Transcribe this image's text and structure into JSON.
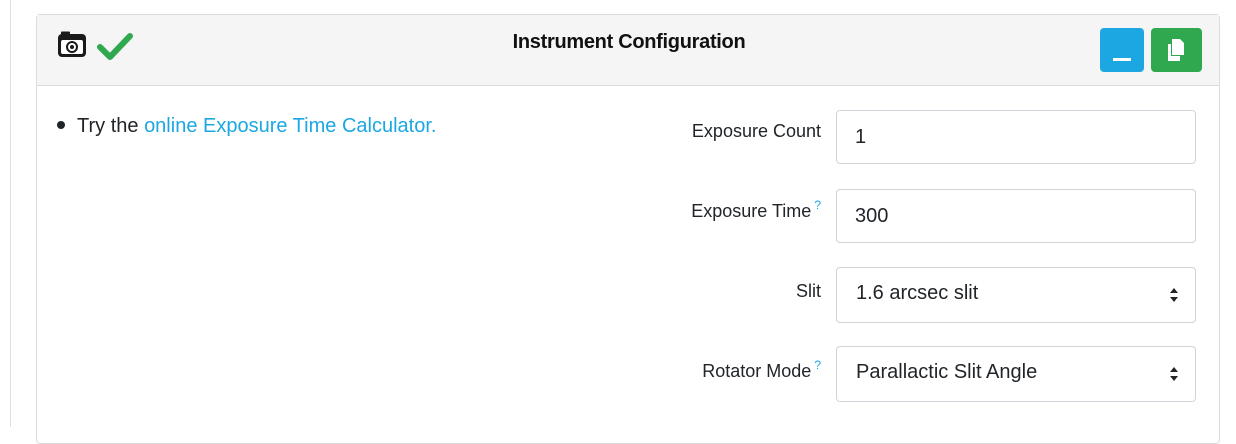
{
  "header": {
    "title": "Instrument Configuration",
    "camera_icon": "camera-icon",
    "status_icon": "check-icon",
    "status_color": "#2fa84f",
    "minimize_color": "#1ca7e3",
    "copy_color": "#2fa84f"
  },
  "hint": {
    "prefix": "Try the ",
    "link_text": "online Exposure Time Calculator.",
    "link_color": "#1ca7e3"
  },
  "fields": {
    "exposure_count": {
      "label": "Exposure Count",
      "value": "1"
    },
    "exposure_time": {
      "label": "Exposure Time",
      "help": "?",
      "value": "300"
    },
    "slit": {
      "label": "Slit",
      "value": "1.6 arcsec slit"
    },
    "rotator_mode": {
      "label": "Rotator Mode",
      "help": "?",
      "value": "Parallactic Slit Angle"
    }
  }
}
